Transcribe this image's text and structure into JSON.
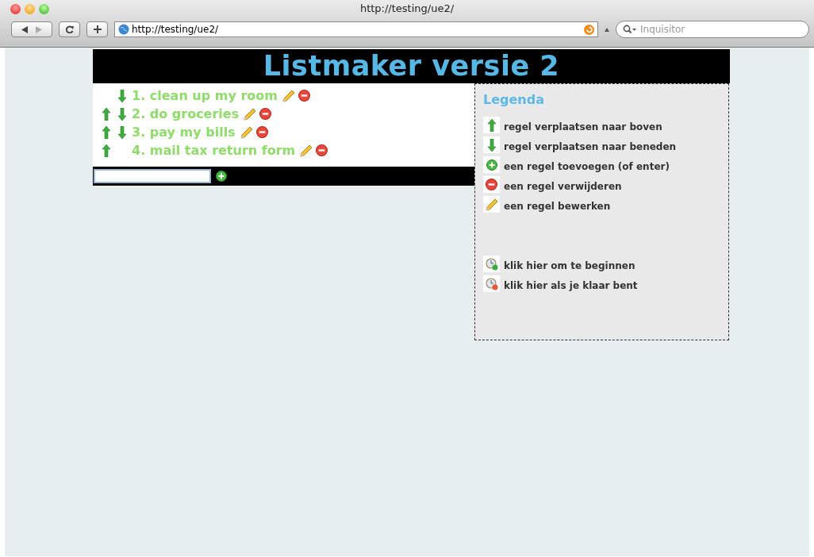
{
  "window": {
    "title": "http://testing/ue2/"
  },
  "toolbar": {
    "address": "http://testing/ue2/",
    "search": {
      "placeholder": "Inquisitor"
    }
  },
  "page": {
    "heading": "Listmaker versie 2",
    "items": [
      {
        "text": "1. clean up my room",
        "up": false,
        "down": true
      },
      {
        "text": "2. do groceries",
        "up": true,
        "down": true
      },
      {
        "text": "3. pay my bills",
        "up": true,
        "down": true
      },
      {
        "text": "4. mail tax return form",
        "up": true,
        "down": false
      }
    ],
    "legend": {
      "title": "Legenda",
      "entries": [
        {
          "kind": "up",
          "text": "regel verplaatsen naar boven"
        },
        {
          "kind": "down",
          "text": "regel verplaatsen naar beneden"
        },
        {
          "kind": "add",
          "text": "een regel toevoegen (of enter)"
        },
        {
          "kind": "remove",
          "text": "een regel verwijderen"
        },
        {
          "kind": "edit",
          "text": "een regel bewerken"
        },
        {
          "kind": "start",
          "text": "klik hier om te beginnen"
        },
        {
          "kind": "finish",
          "text": "klik hier als je klaar bent"
        }
      ]
    }
  }
}
